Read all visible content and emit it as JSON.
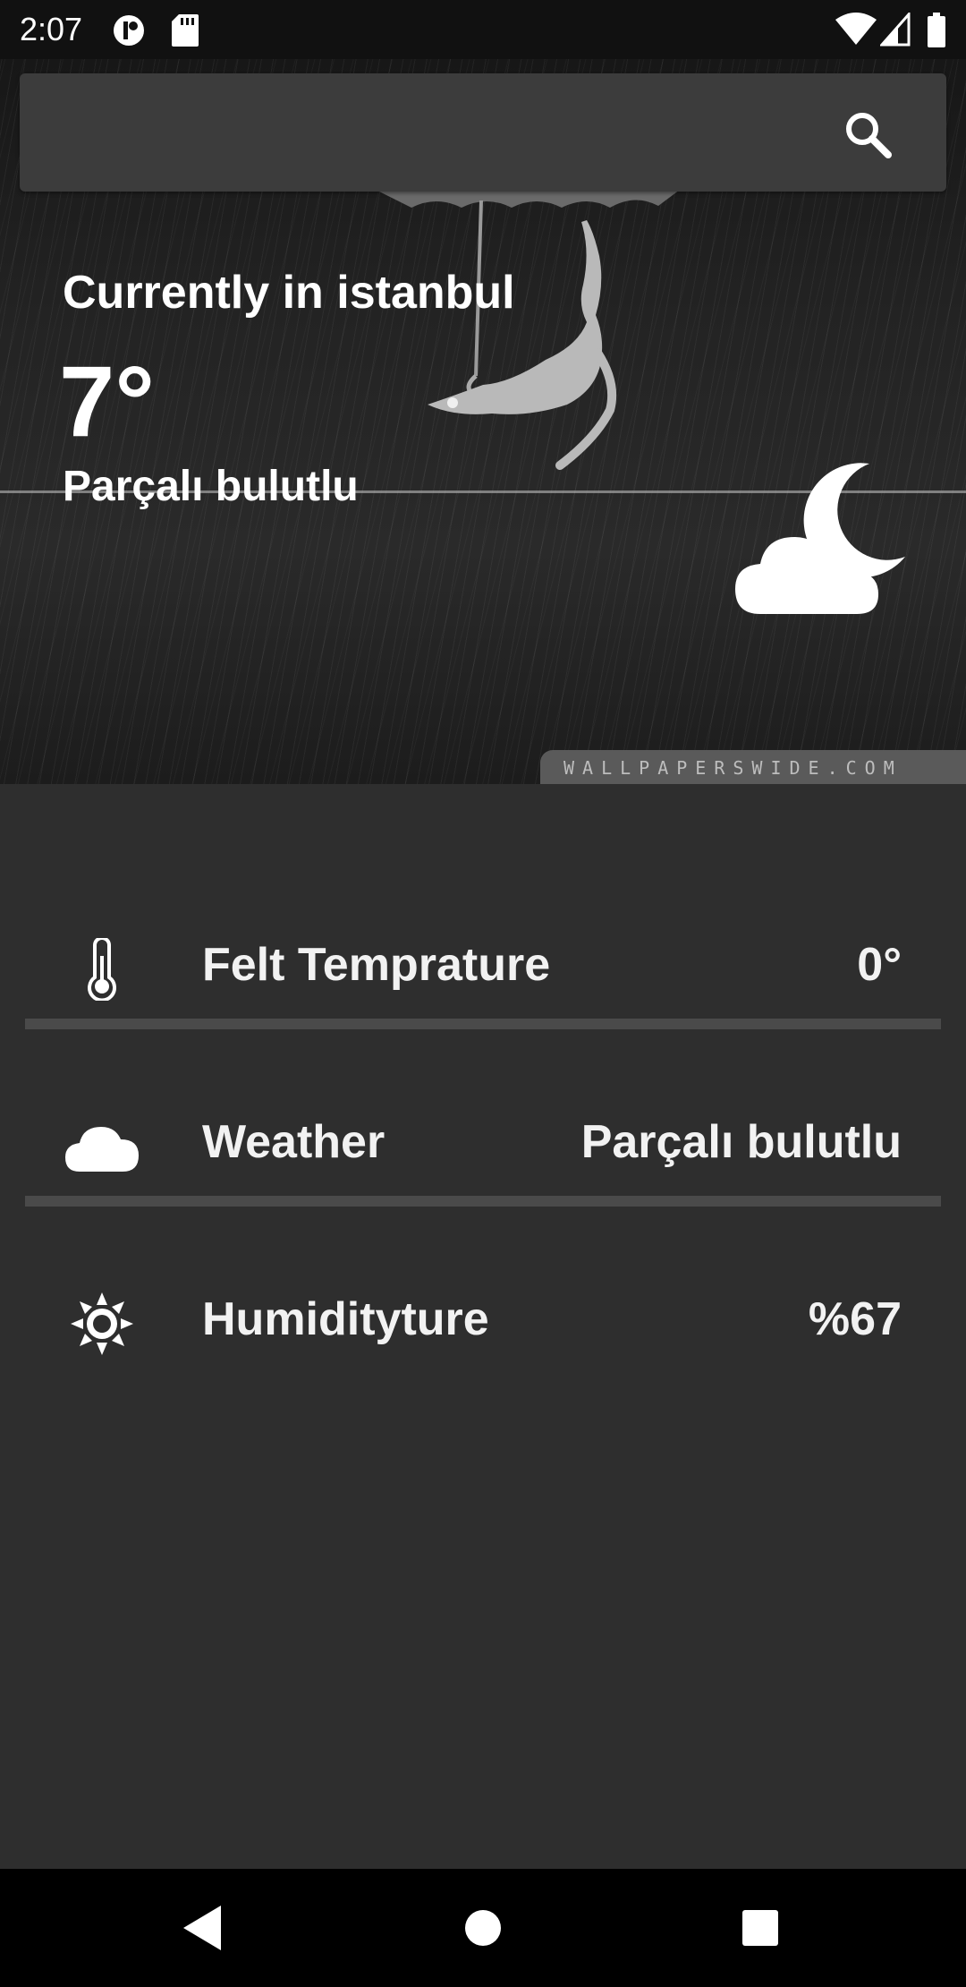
{
  "status_bar": {
    "time": "2:07",
    "icons": [
      "app-notification-icon",
      "sd-card-icon",
      "wifi-icon",
      "signal-icon",
      "battery-icon"
    ]
  },
  "search": {
    "value": "",
    "placeholder": "",
    "icon": "search-icon"
  },
  "current": {
    "title": "Currently in istanbul",
    "temperature": "7°",
    "condition": "Parçalı bulutlu",
    "icon": "moon-cloud-icon"
  },
  "background": {
    "watermark": "WALLPAPERSWIDE.COM"
  },
  "details": [
    {
      "icon": "thermometer-icon",
      "label": "Felt Temprature",
      "value": "0°"
    },
    {
      "icon": "cloud-icon",
      "label": "Weather",
      "value": "Parçalı bulutlu"
    },
    {
      "icon": "sun-icon",
      "label": "Humidityture",
      "value": "%67"
    }
  ],
  "nav_bar": {
    "buttons": [
      "back-icon",
      "home-icon",
      "recents-icon"
    ]
  },
  "colors": {
    "background": "#2e2e2e",
    "search_box": "#3c3c3c",
    "divider": "#4a4a4a",
    "text": "#ffffff"
  }
}
